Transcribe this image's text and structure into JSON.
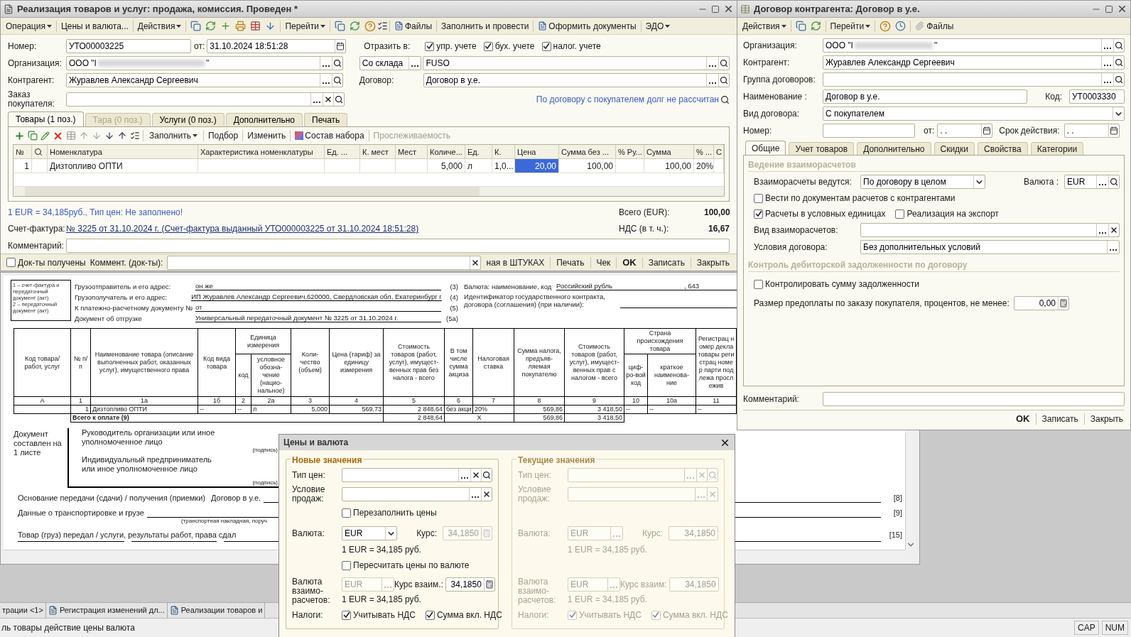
{
  "main_window": {
    "title": "Реализация товаров и услуг: продажа, комиссия. Проведен *",
    "toolbar": [
      {
        "kind": "menu",
        "label": "Операция"
      },
      {
        "kind": "button",
        "label": "Цены и валюта..."
      },
      {
        "kind": "menu",
        "label": "Действия"
      },
      {
        "kind": "icons3"
      },
      {
        "kind": "menu",
        "label": "Перейти"
      },
      {
        "kind": "icons2"
      },
      {
        "kind": "file",
        "label": "Файлы"
      },
      {
        "kind": "button",
        "label": "Заполнить и провести"
      },
      {
        "kind": "file",
        "label": "Оформить документы"
      },
      {
        "kind": "menu",
        "label": "ЭДО"
      }
    ],
    "number_label": "Номер:",
    "number": "УТО00003225",
    "date_label": "от:",
    "date": "31.10.2024 18:51:28",
    "reflect_label": "Отразить в:",
    "reflect": [
      {
        "label": "упр. учете",
        "checked": true
      },
      {
        "label": "бух. учете",
        "checked": true
      },
      {
        "label": "налог. учете",
        "checked": true
      }
    ],
    "org_label": "Организация:",
    "org_prefix": "ООО \"I",
    "org_suffix": "\"",
    "warehouse_kind": "Со склада",
    "warehouse": "FUSO",
    "contractor_label": "Контрагент:",
    "contractor": "Журавлев Александр Сергеевич",
    "contract_label": "Договор:",
    "contract": "Договор в у.е.",
    "order_label": "Заказ покупателя:",
    "debt_link": "По договору с покупателем долг не рассчитан",
    "tabs": [
      {
        "label": "Товары (1 поз.)",
        "selected": true,
        "disabled": false
      },
      {
        "label": "Тара (0 поз.)",
        "selected": false,
        "disabled": true
      },
      {
        "label": "Услуги (0 поз.)",
        "selected": false,
        "disabled": false
      },
      {
        "label": "Дополнительно",
        "selected": false,
        "disabled": false
      },
      {
        "label": "Печать",
        "selected": false,
        "disabled": false
      }
    ],
    "table_toolbar": [
      {
        "kind": "menu",
        "label": "Заполнить"
      },
      {
        "kind": "button",
        "label": "Подбор"
      },
      {
        "kind": "button",
        "label": "Изменить"
      },
      {
        "kind": "set",
        "label": "Состав набора"
      },
      {
        "kind": "disabled",
        "label": "Прослеживаемость"
      }
    ],
    "columns": [
      "№",
      null,
      "Номенклатура",
      "Характеристика номенклатуры",
      "Ед. ...",
      "К. мест",
      "Мест",
      "Количе...",
      "Ед.",
      "К.",
      "Цена",
      "Сумма без ...",
      "% Ру...",
      "Сумма",
      "% ...",
      "С"
    ],
    "rows": [
      {
        "cells": [
          {
            "text": "1",
            "selected": false
          },
          {
            "selected": false
          },
          {
            "text": "Дизтопливо ОПТИ",
            "selected": false
          },
          {
            "selected": false
          },
          {
            "selected": false
          },
          {
            "selected": false
          },
          {
            "selected": false
          },
          {
            "text": "5,000",
            "selected": false
          },
          {
            "text": "л",
            "selected": false
          },
          {
            "text": "1,0...",
            "selected": false
          },
          {
            "text": "20,00",
            "selected": true
          },
          {
            "text": "100,00",
            "selected": false
          },
          {
            "selected": false
          },
          {
            "text": "100,00",
            "selected": false
          },
          {
            "text": "20%",
            "selected": false
          },
          {
            "selected": false
          }
        ]
      }
    ],
    "rate_note": "1 EUR = 34,185руб., Тип цен: Не заполнено!",
    "total_label": "Всего (EUR):",
    "total": "100,00",
    "invoice_label": "Счет-фактура:",
    "invoice_link": "№ 3225 от 31.10.2024 г. (Счет-фактура выданный УТО000003225 от 31.10.2024 18:51:28)",
    "vat_label": "НДС (в т. ч.):",
    "vat": "16,67",
    "comment_label": "Комментарий:",
    "docs_received": {
      "label": "Док-ты получены",
      "checked": false
    },
    "docs_comment_label": "Коммент. (док-ты):",
    "bottom_buttons": [
      {
        "label": "ная в ШТУКАХ",
        "bold": false
      },
      {
        "label": "Печать",
        "bold": false
      },
      {
        "label": "Чек",
        "bold": false
      },
      {
        "label": "OK",
        "bold": true
      },
      {
        "label": "Записать",
        "bold": false
      },
      {
        "label": "Закрыть",
        "bold": false
      }
    ]
  },
  "print_form": {
    "legend": [
      "1 – счет-фактура и передаточный документ (акт)",
      "2 – передаточный документ (акт)"
    ],
    "header": [
      {
        "label": "Грузоотправитель и его адрес:",
        "value": "он же",
        "ref": "(3)"
      },
      {
        "label": "Грузополучатель и его адрес:",
        "value": "ИП Журавлев Александр Сергеевич,620000, Свердловская обл, Екатеринбург г",
        "ref": "(4)"
      },
      {
        "label": "К платежно-расчетному документу №",
        "value": "от",
        "ref": "(5)"
      },
      {
        "label": "Документ об отгрузке",
        "value": "Универсальный передаточный документ № 3225 от 31.10.2024 г.",
        "ref": "(5а)"
      }
    ],
    "currency_label": "Валюта: наименование, код",
    "currency": "Российский рубль",
    "currency_code": ", 643",
    "contract_id_label": "Идентификатор государственного контракта, договора (соглашения) (при наличии):",
    "col_headers": {
      "code": "Код товара/ работ, услуг",
      "num": "№ п/п",
      "name": "Наименование товара (описание выполненных работ, оказанных услуг), имущественного права",
      "kind_code": "Код вида товара",
      "unit": "Единица измерения",
      "unit_code": "код",
      "unit_name": "условное обозна-чение (нацио-нальное)",
      "qty": "Коли-чество (объем)",
      "price": "Цена (тариф) за единицу измерения",
      "cost": "Стоимость товаров (работ, услуг), имущест-венных прав без налога - всего",
      "excise": "В том числе сумма акциза",
      "rate": "Налоговая ставка",
      "tax": "Сумма налога, предъяв-ляемая покупателю",
      "cost_tax": "Стоимость товаров (работ, услуг), имущест-венных прав с налогом - всего",
      "country": "Страна происхождения товара",
      "country_code": "циф-ро-вой код",
      "country_name": "краткое наименова-ние",
      "reg": "Регистрац номер декла товары регистрац номер парти подлежа прослежив"
    },
    "col_numbers": [
      "А",
      "1",
      "1а",
      "1б",
      "2",
      "2а",
      "3",
      "4",
      "5",
      "6",
      "7",
      "8",
      "9",
      "10",
      "10а",
      "11"
    ],
    "row": [
      "1",
      "Дизтопливо ОПТИ",
      "--",
      "--",
      "л",
      "5,000",
      "569,73",
      "2 848,64",
      "без акци",
      "20%",
      "569,86",
      "3 418,50",
      "--",
      "--",
      "--"
    ],
    "total_label": "Всего к оплате (9)",
    "total_cost": "2 848,64",
    "total_excise": "X",
    "total_tax": "569,86",
    "total_sum": "3 418,50",
    "sheets": "Документ составлен на 1 листе",
    "head": "Руководитель организации или иное уполномоченное лицо",
    "signature": "(подпись)",
    "entrepreneur": "Индивидуальный предприниматель или иное уполномоченное лицо",
    "signature2": "(подпись)",
    "basis_label": "Основание передачи (сдачи) / получения (приемки)",
    "basis": "Договор в у.е.",
    "basis_ref": "[8]",
    "transport_label": "Данные о транспортировке и грузе",
    "transport_ref": "[9]",
    "transport_hint": "(транспортная накладная, поруч",
    "handed_label": "Товар (груз) передал / услуги, результаты работ, права сдал",
    "handed_ref": "[15]"
  },
  "contract_window": {
    "title": "Договор контрагента: Договор в у.е.",
    "toolbar": [
      {
        "kind": "menu",
        "label": "Действия"
      },
      {
        "kind": "icons2"
      },
      {
        "kind": "menu",
        "label": "Перейти"
      },
      {
        "kind": "help"
      },
      {
        "kind": "file",
        "label": "Файлы"
      }
    ],
    "org_label": "Организация:",
    "org_prefix": "ООО \"I",
    "org_suffix": "\"",
    "contractor_label": "Контрагент:",
    "contractor": "Журавлев Александр Сергеевич",
    "group_label": "Группа договоров:",
    "name_label": "Наименование :",
    "name": "Договор в у.е.",
    "code_label": "Код:",
    "code": "УТ0003330",
    "type_label": "Вид договора:",
    "type": "С покупателем",
    "number_label": "Номер:",
    "from_label": "от:",
    "date_empty": ". .",
    "term_label": "Срок действия:",
    "term_empty": ". .",
    "tabs": [
      {
        "label": "Общие",
        "selected": true
      },
      {
        "label": "Учет товаров",
        "selected": false
      },
      {
        "label": "Дополнительно",
        "selected": false
      },
      {
        "label": "Скидки",
        "selected": false
      },
      {
        "label": "Свойства",
        "selected": false
      },
      {
        "label": "Категории",
        "selected": false
      }
    ],
    "settlements_group": "Ведение взаиморасчетов",
    "settlements_label": "Взаиморасчеты ведутся:",
    "settlements": "По договору в целом",
    "currency_label": "Валюта :",
    "currency": "EUR",
    "by_docs": {
      "label": "Вести по документам расчетов с контрагентами",
      "checked": false
    },
    "conventional": {
      "label": "Расчеты в условных единицах",
      "checked": true
    },
    "export": {
      "label": "Реализация на экспорт",
      "checked": false
    },
    "settlement_kind_label": "Вид взаиморасчетов:",
    "terms_label": "Условия договора:",
    "terms": "Без дополнительных условий",
    "debt_group": "Контроль дебиторской задолженности по договору",
    "control_debt": {
      "label": "Контролировать сумму задолженности",
      "checked": false
    },
    "prepay_label": "Размер предоплаты по заказу покупателя, процентов, не менее:",
    "prepay": "0,00",
    "comment_label": "Комментарий:",
    "buttons": [
      {
        "label": "OK",
        "bold": true
      },
      {
        "label": "Записать",
        "bold": false
      },
      {
        "label": "Закрыть",
        "bold": false
      }
    ]
  },
  "dialog": {
    "title": "Цены и валюта",
    "groups": [
      {
        "title": "Новые значения",
        "disabled": false,
        "price_type_label": "Тип цен:",
        "sale_label": "Условие продаж:",
        "refill": {
          "label": "Перезаполнить цены",
          "checked": false
        },
        "currency_label": "Валюта:",
        "currency": "EUR",
        "rate_label": "Курс:",
        "rate": "34,1850",
        "rate_note": "1 EUR = 34,185 руб.",
        "recalc": {
          "label": "Пересчитать цены по валюте",
          "checked": false
        },
        "settle_label": "Валюта взаимо-расчетов:",
        "settle_currency": "EUR",
        "settle_rate_label": "Курс взаим.:",
        "settle_rate": "34,1850",
        "settle_note": "1 EUR = 34,185 руб.",
        "taxes_label": "Налоги:",
        "vat": {
          "label": "Учитывать НДС",
          "checked": true
        },
        "vat_incl": {
          "label": "Сумма вкл. НДС",
          "checked": true
        }
      },
      {
        "title": "Текущие значения",
        "disabled": true,
        "price_type_label": "Тип цен:",
        "sale_label": "Условие продаж:",
        "currency_label": "Валюта:",
        "currency": "EUR",
        "rate_label": "Курс:",
        "rate": "34,1850",
        "rate_note": "1 EUR = 34,185 руб.",
        "settle_label": "Валюта взаимо-расчетов:",
        "settle_currency": "EUR",
        "settle_rate_label": "Курс взаим:",
        "settle_rate": "34,1850",
        "settle_note": "1 EUR = 34,185 руб.",
        "taxes_label": "Налоги:",
        "vat": {
          "label": "Учитывать НДС",
          "checked": true
        },
        "vat_incl": {
          "label": "Сумма вкл. НДС",
          "checked": true
        }
      }
    ]
  },
  "taskbar": [
    {
      "label": "трации <1>",
      "icon": false
    },
    {
      "label": "Регистрация изменений дл...",
      "icon": true
    },
    {
      "label": "Реализации товаров и",
      "icon": true
    }
  ],
  "status_bar": {
    "text": "ль товары действие цены валюта",
    "indicators": [
      "CAP",
      "NUM"
    ]
  }
}
